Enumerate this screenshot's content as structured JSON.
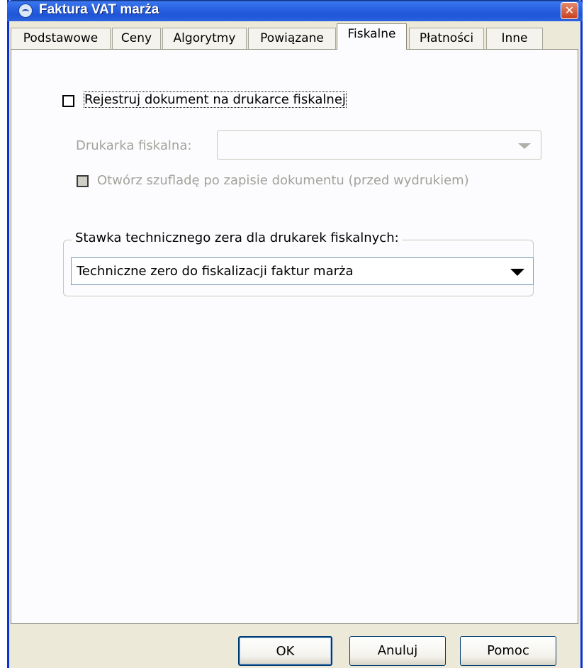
{
  "window": {
    "title": "Faktura VAT marża",
    "close_symbol": "✕",
    "icon": "app-logo-icon"
  },
  "tabs": [
    {
      "label": "Podstawowe",
      "active": false
    },
    {
      "label": "Ceny",
      "active": false
    },
    {
      "label": "Algorytmy",
      "active": false
    },
    {
      "label": "Powiązane",
      "active": false
    },
    {
      "label": "Fiskalne",
      "active": true
    },
    {
      "label": "Płatności",
      "active": false
    },
    {
      "label": "Inne",
      "active": false
    }
  ],
  "fiscal": {
    "register_checkbox_label": "Rejestruj dokument na drukarce fiskalnej",
    "register_checked": false,
    "printer_label": "Drukarka fiskalna:",
    "printer_value": "",
    "drawer_checkbox_label": "Otwórz szufladę po zapisie dokumentu (przed wydrukiem)",
    "drawer_checked": false,
    "group_title": "Stawka technicznego zera dla drukarek fiskalnych:",
    "rate_value": "Techniczne zero do fiskalizacji faktur marża"
  },
  "buttons": {
    "ok": "OK",
    "cancel": "Anuluj",
    "help": "Pomoc"
  }
}
